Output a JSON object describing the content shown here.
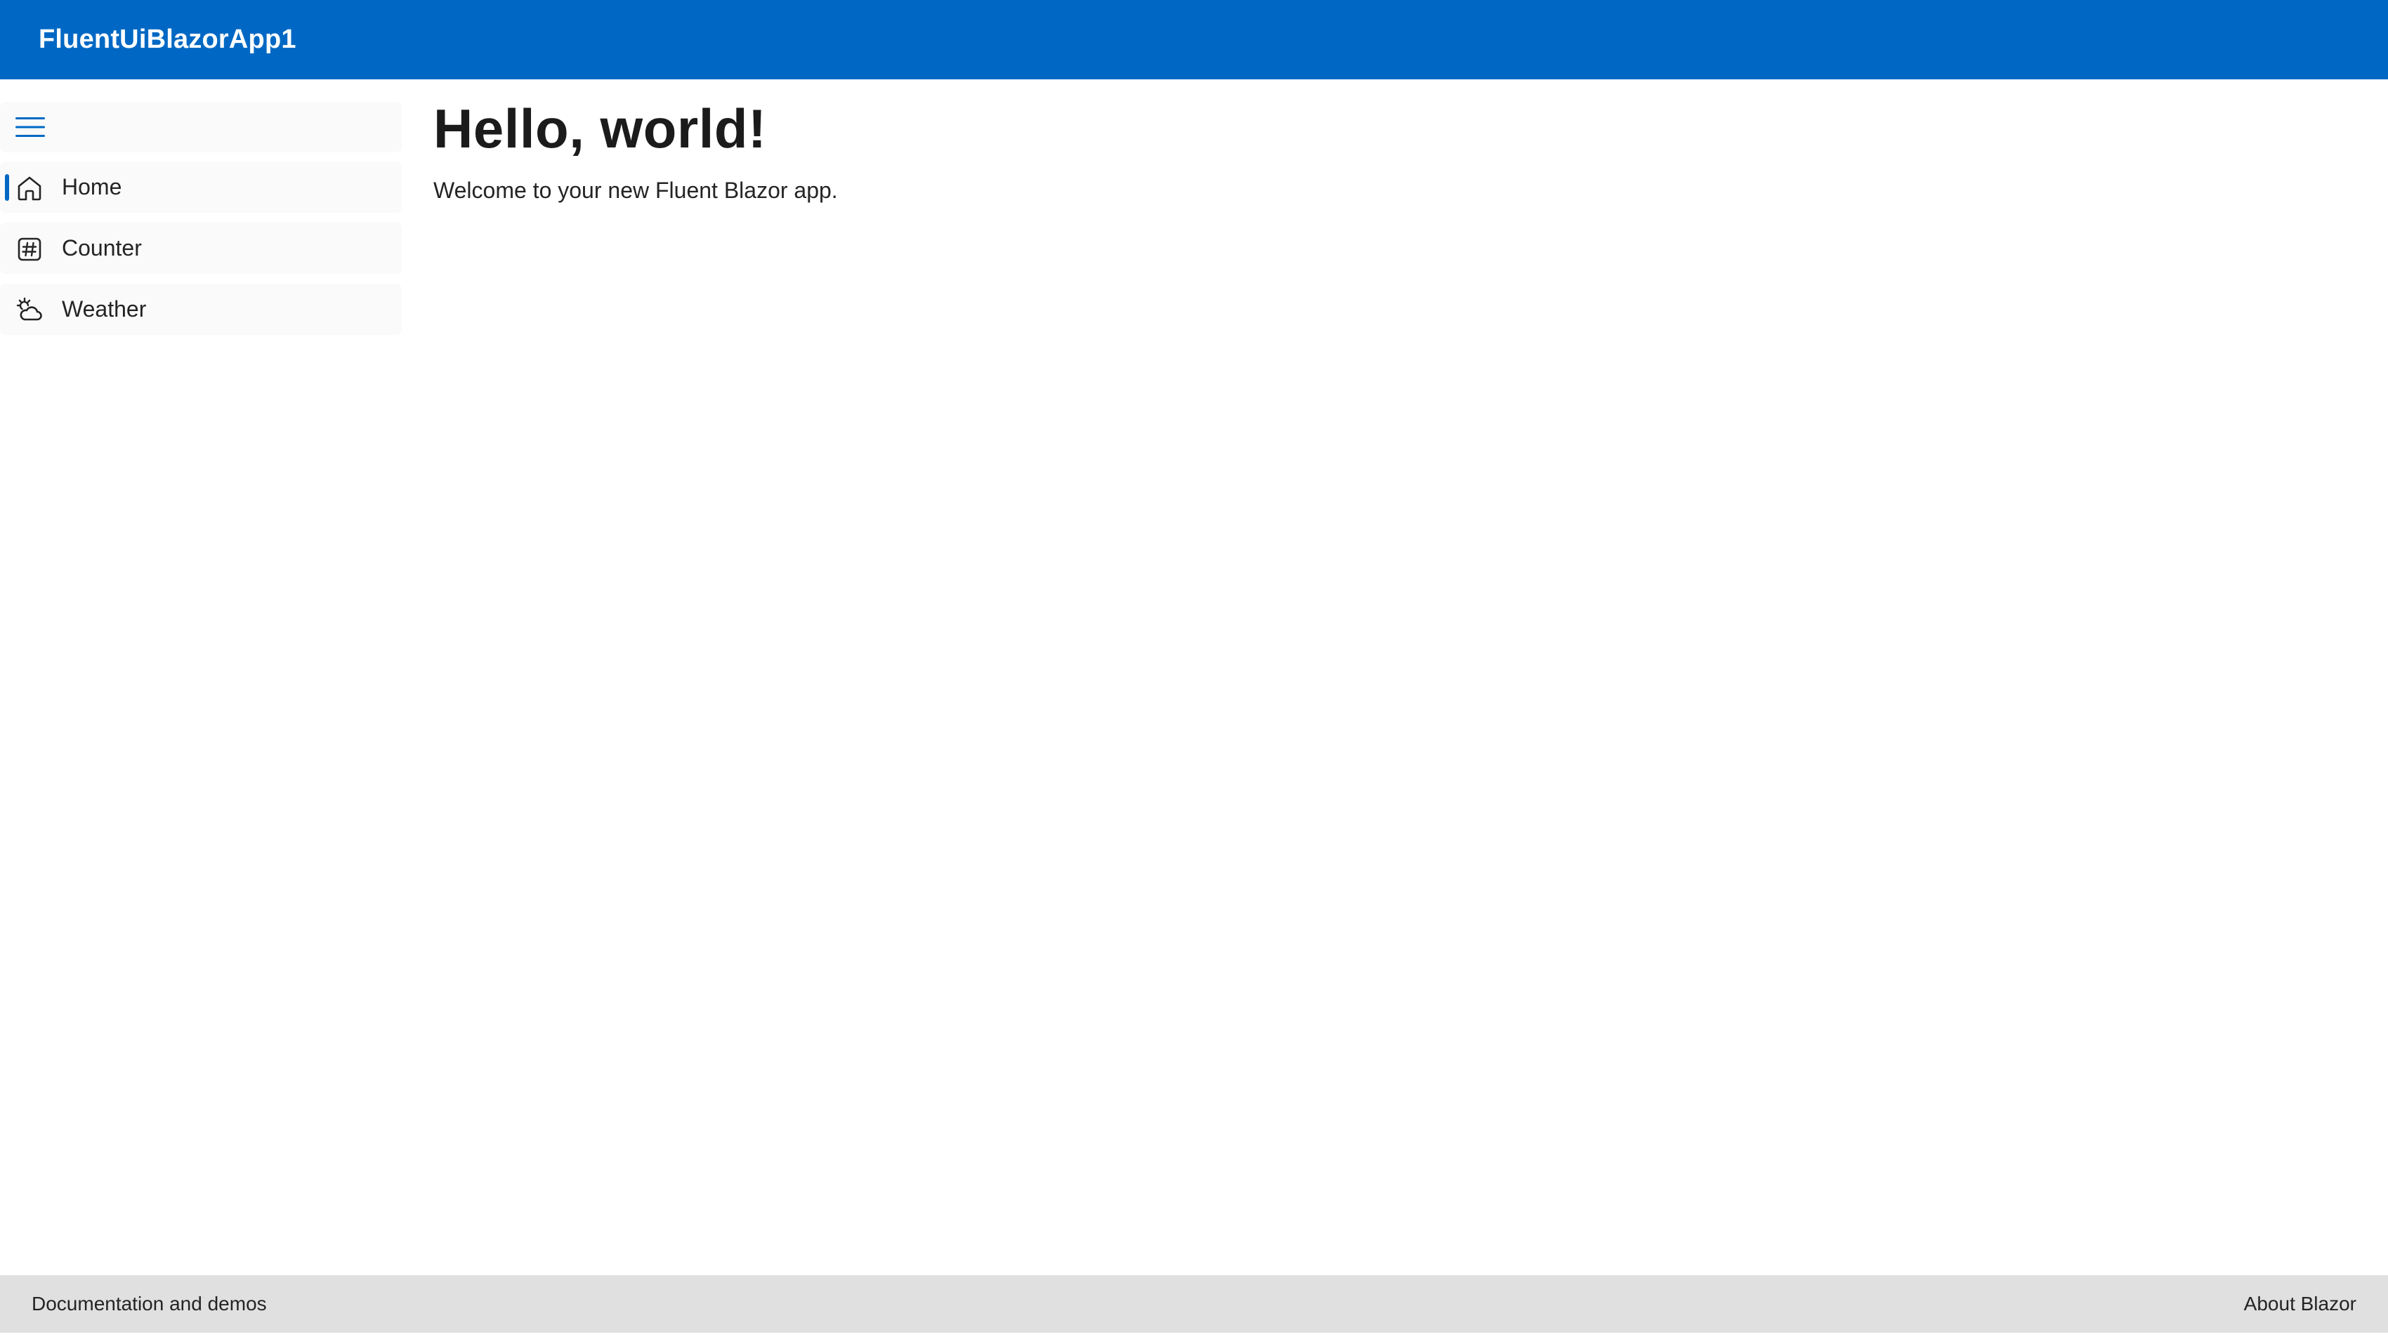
{
  "header": {
    "title": "FluentUiBlazorApp1"
  },
  "sidebar": {
    "toggle_icon": "hamburger-menu-icon",
    "items": [
      {
        "label": "Home",
        "icon": "home-icon",
        "active": true
      },
      {
        "label": "Counter",
        "icon": "number-symbol-icon",
        "active": false
      },
      {
        "label": "Weather",
        "icon": "weather-partly-cloudy-icon",
        "active": false
      }
    ]
  },
  "main": {
    "title": "Hello, world!",
    "text": "Welcome to your new Fluent Blazor app."
  },
  "footer": {
    "left_link": "Documentation and demos",
    "right_link": "About Blazor"
  },
  "colors": {
    "accent": "#0068c4",
    "footer_bg": "#e0e0e0",
    "nav_bg": "#fafafa"
  }
}
